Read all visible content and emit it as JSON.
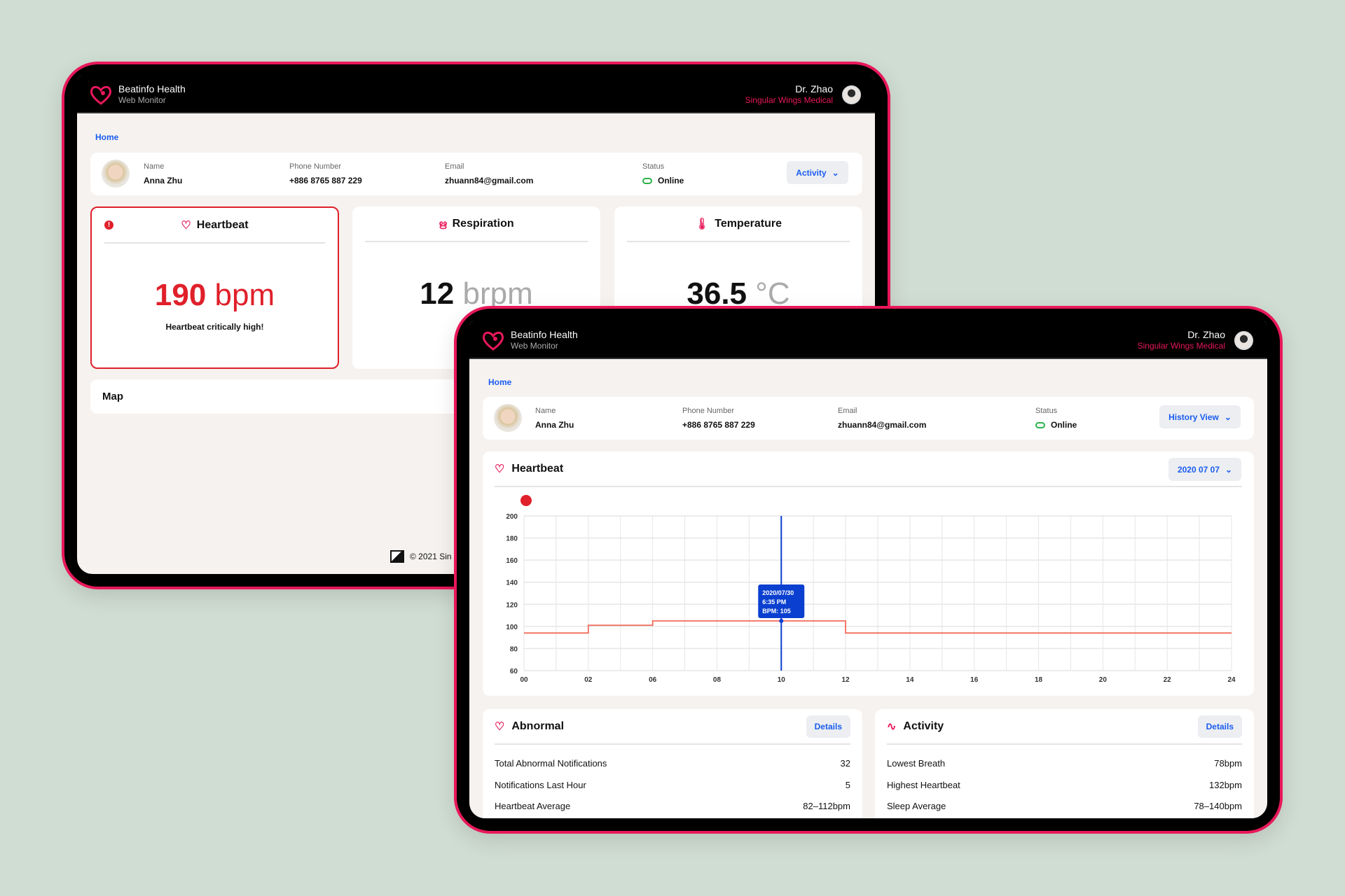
{
  "app": {
    "title": "Beatinfo Health",
    "subtitle": "Web Monitor",
    "user_name": "Dr. Zhao",
    "user_org": "Singular Wings Medical",
    "breadcrumb": "Home"
  },
  "colors": {
    "accent": "#e8185a",
    "link": "#1a5cf0",
    "alert": "#e0202a",
    "line": "#f26a5a",
    "cursor": "#0a3fd0",
    "online": "#2bb24c"
  },
  "patient": {
    "labels": {
      "name": "Name",
      "phone": "Phone Number",
      "email": "Email",
      "status": "Status"
    },
    "name": "Anna Zhu",
    "phone": "+886 8765 887 229",
    "email": "zhuann84@gmail.com",
    "status": "Online"
  },
  "back": {
    "view_select": "Activity",
    "metrics": [
      {
        "title": "Heartbeat",
        "icon": "heart-icon",
        "value": "190",
        "unit": "bpm",
        "note": "Heartbeat critically high!",
        "alert": true
      },
      {
        "title": "Respiration",
        "icon": "lungs-icon",
        "value": "12",
        "unit": "brpm"
      },
      {
        "title": "Temperature",
        "icon": "thermometer-icon",
        "value": "36.5",
        "unit": "°C"
      }
    ],
    "map_title": "Map",
    "footer": "© 2021 Sin"
  },
  "front": {
    "view_select": "History View",
    "chart_title": "Heartbeat",
    "date_select": "2020 07 07",
    "details_label": "Details",
    "abnormal": {
      "title": "Abnormal",
      "rows": [
        {
          "label": "Total Abnormal Notifications",
          "value": "32"
        },
        {
          "label": "Notifications Last Hour",
          "value": "5"
        },
        {
          "label": "Heartbeat Average",
          "value": "82–112bpm"
        }
      ]
    },
    "activity": {
      "title": "Activity",
      "rows": [
        {
          "label": "Lowest Breath",
          "value": "78bpm"
        },
        {
          "label": "Highest Heartbeat",
          "value": "132bpm"
        },
        {
          "label": "Sleep Average",
          "value": "78–140bpm"
        }
      ]
    }
  },
  "chart_data": {
    "type": "line",
    "step": true,
    "x_tick_labels": [
      "00",
      "02",
      "06",
      "08",
      "10",
      "12",
      "14",
      "16",
      "18",
      "20",
      "22",
      "24"
    ],
    "y_ticks": [
      60,
      80,
      100,
      120,
      140,
      160,
      180,
      200
    ],
    "ylim": [
      60,
      200
    ],
    "grid": true,
    "series": [
      {
        "color": "#f26a5a",
        "steps": [
          {
            "from": "00",
            "to": "02",
            "bpm": 94
          },
          {
            "from": "02",
            "to": "06",
            "bpm": 101
          },
          {
            "from": "06",
            "to": "12",
            "bpm": 105
          },
          {
            "from": "12",
            "to": "24",
            "bpm": 94
          }
        ]
      }
    ],
    "tooltip": {
      "at": "10",
      "bpm": 105,
      "lines": [
        "2020/07/30",
        "6:35 PM",
        "BPM: 105"
      ]
    }
  }
}
